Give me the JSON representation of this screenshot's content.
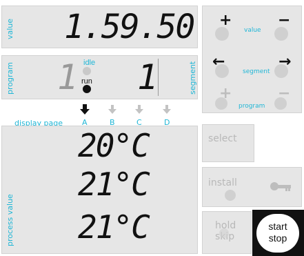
{
  "display": {
    "value_label": "value",
    "value_reading": "1.59.50",
    "program_label": "program",
    "program_number": "1",
    "segment_label": "segment",
    "segment_number": "1",
    "status_idle": "idle",
    "status_run": "run",
    "display_page_label": "display page",
    "pages": [
      "A",
      "B",
      "C",
      "D"
    ],
    "active_page": "A",
    "process_value_label": "process value",
    "pv1": "20°C",
    "pv2": "21°C",
    "pv3": "21°C"
  },
  "buttons": {
    "value_plus": "+",
    "value_minus": "−",
    "value_label": "value",
    "segment_left": "←",
    "segment_right": "→",
    "segment_label": "segment",
    "program_plus": "+",
    "program_minus": "−",
    "program_label": "program",
    "select_label": "select",
    "install_label": "install",
    "hold_label": "hold",
    "skip_label": "skip",
    "start_label": "start",
    "stop_label": "stop"
  },
  "colors": {
    "accent": "#1fb6d6",
    "panel": "#e6e6e6",
    "dark": "#111111"
  }
}
